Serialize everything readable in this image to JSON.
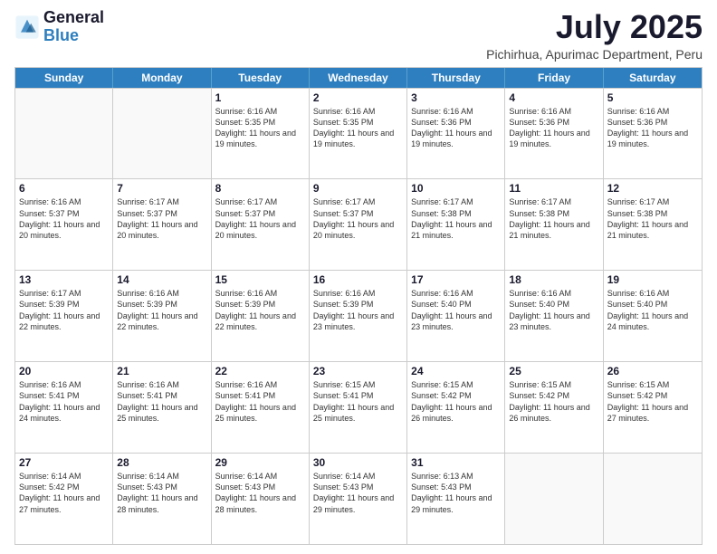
{
  "logo": {
    "line1": "General",
    "line2": "Blue"
  },
  "header": {
    "month": "July 2025",
    "location": "Pichirhua, Apurimac Department, Peru"
  },
  "weekdays": [
    "Sunday",
    "Monday",
    "Tuesday",
    "Wednesday",
    "Thursday",
    "Friday",
    "Saturday"
  ],
  "rows": [
    [
      {
        "day": "",
        "info": ""
      },
      {
        "day": "",
        "info": ""
      },
      {
        "day": "1",
        "info": "Sunrise: 6:16 AM\nSunset: 5:35 PM\nDaylight: 11 hours and 19 minutes."
      },
      {
        "day": "2",
        "info": "Sunrise: 6:16 AM\nSunset: 5:35 PM\nDaylight: 11 hours and 19 minutes."
      },
      {
        "day": "3",
        "info": "Sunrise: 6:16 AM\nSunset: 5:36 PM\nDaylight: 11 hours and 19 minutes."
      },
      {
        "day": "4",
        "info": "Sunrise: 6:16 AM\nSunset: 5:36 PM\nDaylight: 11 hours and 19 minutes."
      },
      {
        "day": "5",
        "info": "Sunrise: 6:16 AM\nSunset: 5:36 PM\nDaylight: 11 hours and 19 minutes."
      }
    ],
    [
      {
        "day": "6",
        "info": "Sunrise: 6:16 AM\nSunset: 5:37 PM\nDaylight: 11 hours and 20 minutes."
      },
      {
        "day": "7",
        "info": "Sunrise: 6:17 AM\nSunset: 5:37 PM\nDaylight: 11 hours and 20 minutes."
      },
      {
        "day": "8",
        "info": "Sunrise: 6:17 AM\nSunset: 5:37 PM\nDaylight: 11 hours and 20 minutes."
      },
      {
        "day": "9",
        "info": "Sunrise: 6:17 AM\nSunset: 5:37 PM\nDaylight: 11 hours and 20 minutes."
      },
      {
        "day": "10",
        "info": "Sunrise: 6:17 AM\nSunset: 5:38 PM\nDaylight: 11 hours and 21 minutes."
      },
      {
        "day": "11",
        "info": "Sunrise: 6:17 AM\nSunset: 5:38 PM\nDaylight: 11 hours and 21 minutes."
      },
      {
        "day": "12",
        "info": "Sunrise: 6:17 AM\nSunset: 5:38 PM\nDaylight: 11 hours and 21 minutes."
      }
    ],
    [
      {
        "day": "13",
        "info": "Sunrise: 6:17 AM\nSunset: 5:39 PM\nDaylight: 11 hours and 22 minutes."
      },
      {
        "day": "14",
        "info": "Sunrise: 6:16 AM\nSunset: 5:39 PM\nDaylight: 11 hours and 22 minutes."
      },
      {
        "day": "15",
        "info": "Sunrise: 6:16 AM\nSunset: 5:39 PM\nDaylight: 11 hours and 22 minutes."
      },
      {
        "day": "16",
        "info": "Sunrise: 6:16 AM\nSunset: 5:39 PM\nDaylight: 11 hours and 23 minutes."
      },
      {
        "day": "17",
        "info": "Sunrise: 6:16 AM\nSunset: 5:40 PM\nDaylight: 11 hours and 23 minutes."
      },
      {
        "day": "18",
        "info": "Sunrise: 6:16 AM\nSunset: 5:40 PM\nDaylight: 11 hours and 23 minutes."
      },
      {
        "day": "19",
        "info": "Sunrise: 6:16 AM\nSunset: 5:40 PM\nDaylight: 11 hours and 24 minutes."
      }
    ],
    [
      {
        "day": "20",
        "info": "Sunrise: 6:16 AM\nSunset: 5:41 PM\nDaylight: 11 hours and 24 minutes."
      },
      {
        "day": "21",
        "info": "Sunrise: 6:16 AM\nSunset: 5:41 PM\nDaylight: 11 hours and 25 minutes."
      },
      {
        "day": "22",
        "info": "Sunrise: 6:16 AM\nSunset: 5:41 PM\nDaylight: 11 hours and 25 minutes."
      },
      {
        "day": "23",
        "info": "Sunrise: 6:15 AM\nSunset: 5:41 PM\nDaylight: 11 hours and 25 minutes."
      },
      {
        "day": "24",
        "info": "Sunrise: 6:15 AM\nSunset: 5:42 PM\nDaylight: 11 hours and 26 minutes."
      },
      {
        "day": "25",
        "info": "Sunrise: 6:15 AM\nSunset: 5:42 PM\nDaylight: 11 hours and 26 minutes."
      },
      {
        "day": "26",
        "info": "Sunrise: 6:15 AM\nSunset: 5:42 PM\nDaylight: 11 hours and 27 minutes."
      }
    ],
    [
      {
        "day": "27",
        "info": "Sunrise: 6:14 AM\nSunset: 5:42 PM\nDaylight: 11 hours and 27 minutes."
      },
      {
        "day": "28",
        "info": "Sunrise: 6:14 AM\nSunset: 5:43 PM\nDaylight: 11 hours and 28 minutes."
      },
      {
        "day": "29",
        "info": "Sunrise: 6:14 AM\nSunset: 5:43 PM\nDaylight: 11 hours and 28 minutes."
      },
      {
        "day": "30",
        "info": "Sunrise: 6:14 AM\nSunset: 5:43 PM\nDaylight: 11 hours and 29 minutes."
      },
      {
        "day": "31",
        "info": "Sunrise: 6:13 AM\nSunset: 5:43 PM\nDaylight: 11 hours and 29 minutes."
      },
      {
        "day": "",
        "info": ""
      },
      {
        "day": "",
        "info": ""
      }
    ]
  ]
}
